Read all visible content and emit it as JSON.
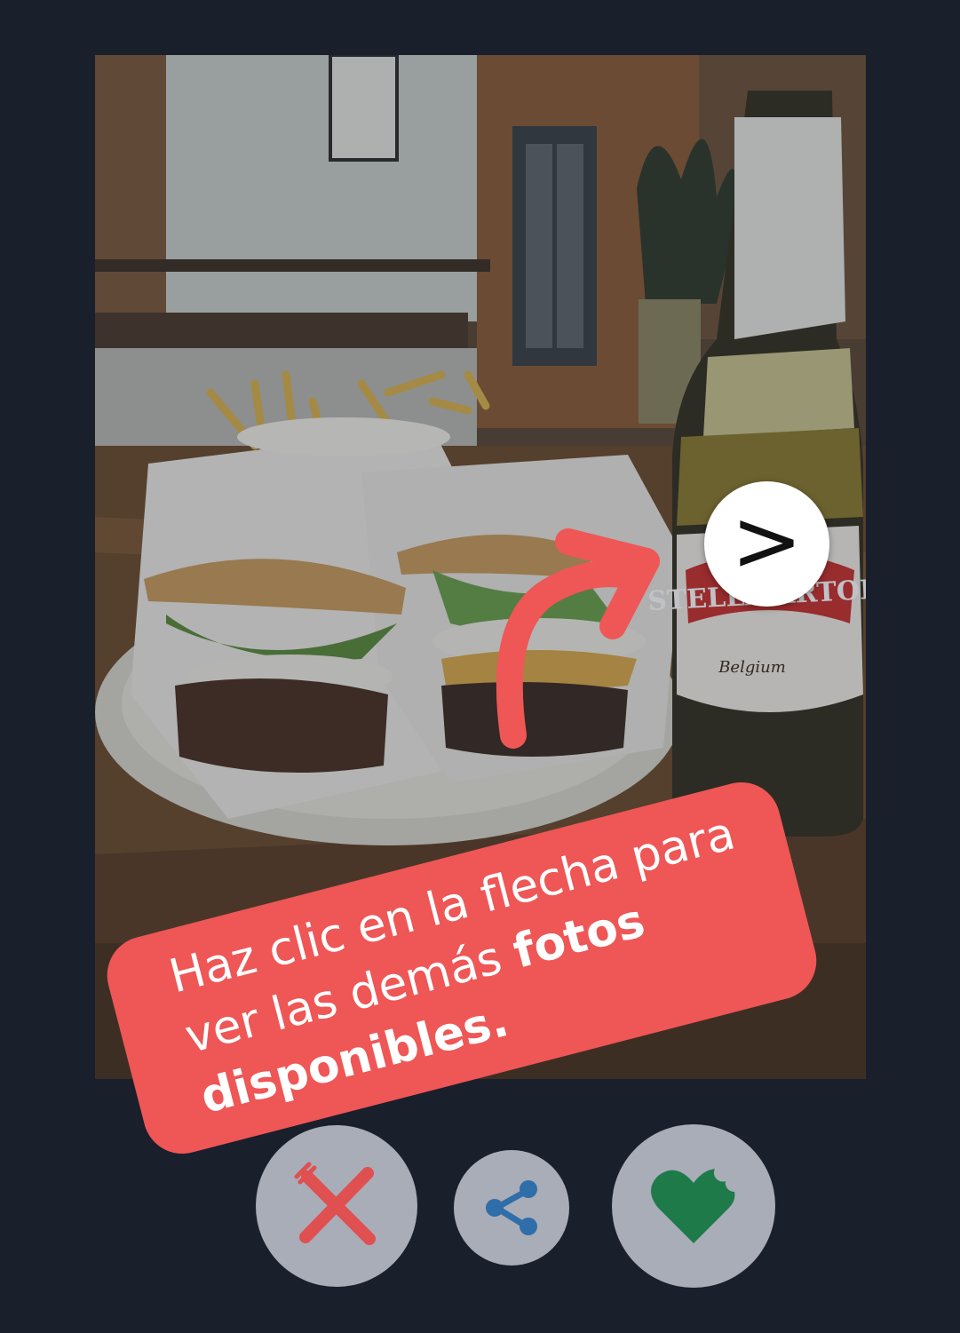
{
  "photo": {
    "label": "STELLA ARTOIS",
    "sublabel": "Belgium"
  },
  "next_button": {
    "glyph": ">"
  },
  "tip": {
    "line1": "Haz clic en la flecha para",
    "line2_regular": "ver las demás ",
    "line2_bold": "fotos",
    "line3_bold": "disponibles."
  },
  "actions": [
    {
      "name": "dislike",
      "icon": "crossed-fork-knife-icon",
      "color": "#e05050"
    },
    {
      "name": "share",
      "icon": "share-icon",
      "color": "#2f6ea8"
    },
    {
      "name": "like",
      "icon": "bitten-heart-icon",
      "color": "#1f7a4a"
    }
  ],
  "colors": {
    "background": "#1a1f2c",
    "callout": "#ef5656",
    "action_button": "#a9adb8"
  }
}
